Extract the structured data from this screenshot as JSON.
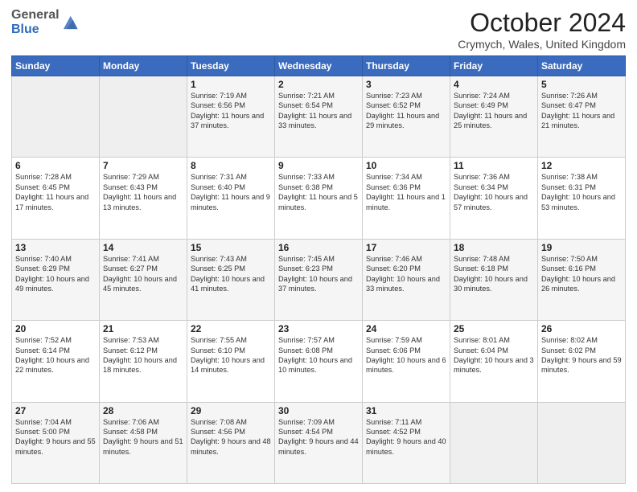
{
  "header": {
    "logo_general": "General",
    "logo_blue": "Blue",
    "month_title": "October 2024",
    "location": "Crymych, Wales, United Kingdom"
  },
  "days_of_week": [
    "Sunday",
    "Monday",
    "Tuesday",
    "Wednesday",
    "Thursday",
    "Friday",
    "Saturday"
  ],
  "weeks": [
    [
      {
        "day": "",
        "info": ""
      },
      {
        "day": "",
        "info": ""
      },
      {
        "day": "1",
        "info": "Sunrise: 7:19 AM\nSunset: 6:56 PM\nDaylight: 11 hours and 37 minutes."
      },
      {
        "day": "2",
        "info": "Sunrise: 7:21 AM\nSunset: 6:54 PM\nDaylight: 11 hours and 33 minutes."
      },
      {
        "day": "3",
        "info": "Sunrise: 7:23 AM\nSunset: 6:52 PM\nDaylight: 11 hours and 29 minutes."
      },
      {
        "day": "4",
        "info": "Sunrise: 7:24 AM\nSunset: 6:49 PM\nDaylight: 11 hours and 25 minutes."
      },
      {
        "day": "5",
        "info": "Sunrise: 7:26 AM\nSunset: 6:47 PM\nDaylight: 11 hours and 21 minutes."
      }
    ],
    [
      {
        "day": "6",
        "info": "Sunrise: 7:28 AM\nSunset: 6:45 PM\nDaylight: 11 hours and 17 minutes."
      },
      {
        "day": "7",
        "info": "Sunrise: 7:29 AM\nSunset: 6:43 PM\nDaylight: 11 hours and 13 minutes."
      },
      {
        "day": "8",
        "info": "Sunrise: 7:31 AM\nSunset: 6:40 PM\nDaylight: 11 hours and 9 minutes."
      },
      {
        "day": "9",
        "info": "Sunrise: 7:33 AM\nSunset: 6:38 PM\nDaylight: 11 hours and 5 minutes."
      },
      {
        "day": "10",
        "info": "Sunrise: 7:34 AM\nSunset: 6:36 PM\nDaylight: 11 hours and 1 minute."
      },
      {
        "day": "11",
        "info": "Sunrise: 7:36 AM\nSunset: 6:34 PM\nDaylight: 10 hours and 57 minutes."
      },
      {
        "day": "12",
        "info": "Sunrise: 7:38 AM\nSunset: 6:31 PM\nDaylight: 10 hours and 53 minutes."
      }
    ],
    [
      {
        "day": "13",
        "info": "Sunrise: 7:40 AM\nSunset: 6:29 PM\nDaylight: 10 hours and 49 minutes."
      },
      {
        "day": "14",
        "info": "Sunrise: 7:41 AM\nSunset: 6:27 PM\nDaylight: 10 hours and 45 minutes."
      },
      {
        "day": "15",
        "info": "Sunrise: 7:43 AM\nSunset: 6:25 PM\nDaylight: 10 hours and 41 minutes."
      },
      {
        "day": "16",
        "info": "Sunrise: 7:45 AM\nSunset: 6:23 PM\nDaylight: 10 hours and 37 minutes."
      },
      {
        "day": "17",
        "info": "Sunrise: 7:46 AM\nSunset: 6:20 PM\nDaylight: 10 hours and 33 minutes."
      },
      {
        "day": "18",
        "info": "Sunrise: 7:48 AM\nSunset: 6:18 PM\nDaylight: 10 hours and 30 minutes."
      },
      {
        "day": "19",
        "info": "Sunrise: 7:50 AM\nSunset: 6:16 PM\nDaylight: 10 hours and 26 minutes."
      }
    ],
    [
      {
        "day": "20",
        "info": "Sunrise: 7:52 AM\nSunset: 6:14 PM\nDaylight: 10 hours and 22 minutes."
      },
      {
        "day": "21",
        "info": "Sunrise: 7:53 AM\nSunset: 6:12 PM\nDaylight: 10 hours and 18 minutes."
      },
      {
        "day": "22",
        "info": "Sunrise: 7:55 AM\nSunset: 6:10 PM\nDaylight: 10 hours and 14 minutes."
      },
      {
        "day": "23",
        "info": "Sunrise: 7:57 AM\nSunset: 6:08 PM\nDaylight: 10 hours and 10 minutes."
      },
      {
        "day": "24",
        "info": "Sunrise: 7:59 AM\nSunset: 6:06 PM\nDaylight: 10 hours and 6 minutes."
      },
      {
        "day": "25",
        "info": "Sunrise: 8:01 AM\nSunset: 6:04 PM\nDaylight: 10 hours and 3 minutes."
      },
      {
        "day": "26",
        "info": "Sunrise: 8:02 AM\nSunset: 6:02 PM\nDaylight: 9 hours and 59 minutes."
      }
    ],
    [
      {
        "day": "27",
        "info": "Sunrise: 7:04 AM\nSunset: 5:00 PM\nDaylight: 9 hours and 55 minutes."
      },
      {
        "day": "28",
        "info": "Sunrise: 7:06 AM\nSunset: 4:58 PM\nDaylight: 9 hours and 51 minutes."
      },
      {
        "day": "29",
        "info": "Sunrise: 7:08 AM\nSunset: 4:56 PM\nDaylight: 9 hours and 48 minutes."
      },
      {
        "day": "30",
        "info": "Sunrise: 7:09 AM\nSunset: 4:54 PM\nDaylight: 9 hours and 44 minutes."
      },
      {
        "day": "31",
        "info": "Sunrise: 7:11 AM\nSunset: 4:52 PM\nDaylight: 9 hours and 40 minutes."
      },
      {
        "day": "",
        "info": ""
      },
      {
        "day": "",
        "info": ""
      }
    ]
  ]
}
